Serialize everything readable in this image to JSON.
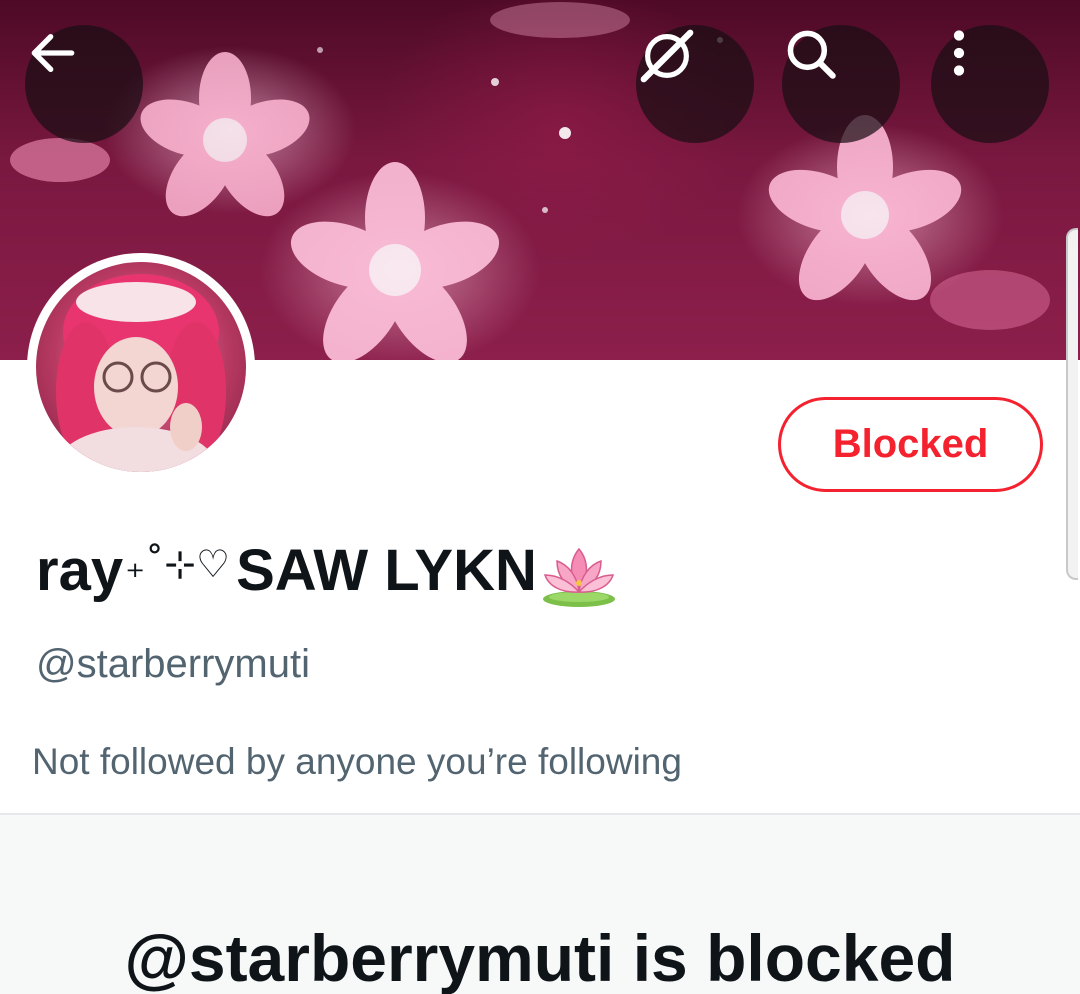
{
  "header": {
    "back_icon": "arrow-left-icon",
    "grok_icon": "grok-icon",
    "search_icon": "search-icon",
    "more_icon": "more-vertical-icon"
  },
  "profile": {
    "display_name": "ray",
    "display_name_decor": "₊˚⊹♡",
    "display_name_suffix": "SAW LYKN",
    "display_name_emoji": "lotus-emoji",
    "handle": "@starberrymuti",
    "followers_note": "Not followed by anyone you’re following",
    "relationship_button": "Blocked"
  },
  "blocked_notice": {
    "title": "@starberrymuti is blocked"
  },
  "colors": {
    "blocked_red": "#f4212e",
    "text_primary": "#0f1419",
    "text_secondary": "#536471",
    "banner_base": "#7a1840"
  }
}
